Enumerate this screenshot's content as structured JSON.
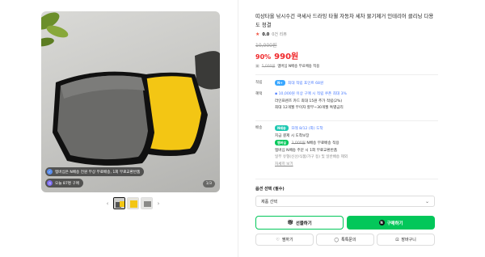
{
  "gallery": {
    "badges": [
      {
        "icon": "delivery-icon",
        "text": "멤버십은 N배송 전원 무상 무료배송, 1회 무료교환반품"
      },
      {
        "icon": "clock-icon",
        "text": "오늘 87명 구매"
      }
    ],
    "counter": "1/3",
    "prev_arrow": "‹",
    "next_arrow": "›"
  },
  "product": {
    "title": "띠상타올 낚시수건 극세사 드라잉 타월 자동차 세차 물기제거 인테리어 클리닝 다용도 청결",
    "rating_star": "★",
    "rating_score": "0.0",
    "rating_count": "0건 리뷰",
    "original_price": "10,000원",
    "discount": "90%",
    "sale_price": "990원",
    "pricebox": {
      "icon": "coupon-icon",
      "old": "5,000원",
      "text": "멤버십 N배송 무료배송 적용"
    }
  },
  "rows": {
    "point": {
      "label": "적립",
      "tag": "N+",
      "text": "최대 적립 포인트 68원"
    },
    "benefit": {
      "label": "혜택",
      "line1_icon": "card-icon",
      "line1": "10,000원 이상 구매 시 적립 쿠폰 최대 3%",
      "line2": "라인프렌즈 카드 최대 15원 추가 적립(2%)",
      "line3": "최대 12개월 무이자 할부~30개월 특별금리"
    },
    "delivery": {
      "label": "배송",
      "tag": "N배송",
      "eta": "모레 8/12 (화) 도착",
      "line2": "지금 결제 시 도착보장",
      "line3_tag": "멤버십",
      "line3_old": "3,000원",
      "line3": "N배송 무료배송 적용",
      "line4": "멤버십 N배송 주문 시 1회 무료교환반품",
      "line5": "일부 유형(신선/식품/가구 등) 및 일반배송 제외",
      "more": "자세히 보기"
    }
  },
  "options": {
    "label": "옵션 선택 (필수)",
    "select_value": "제품 선택"
  },
  "actions": {
    "gift": "선물하기",
    "buy_badge": "N",
    "buy": "구매하기",
    "like": "찜하기",
    "talk": "톡톡문의",
    "cart": "장바구니"
  }
}
